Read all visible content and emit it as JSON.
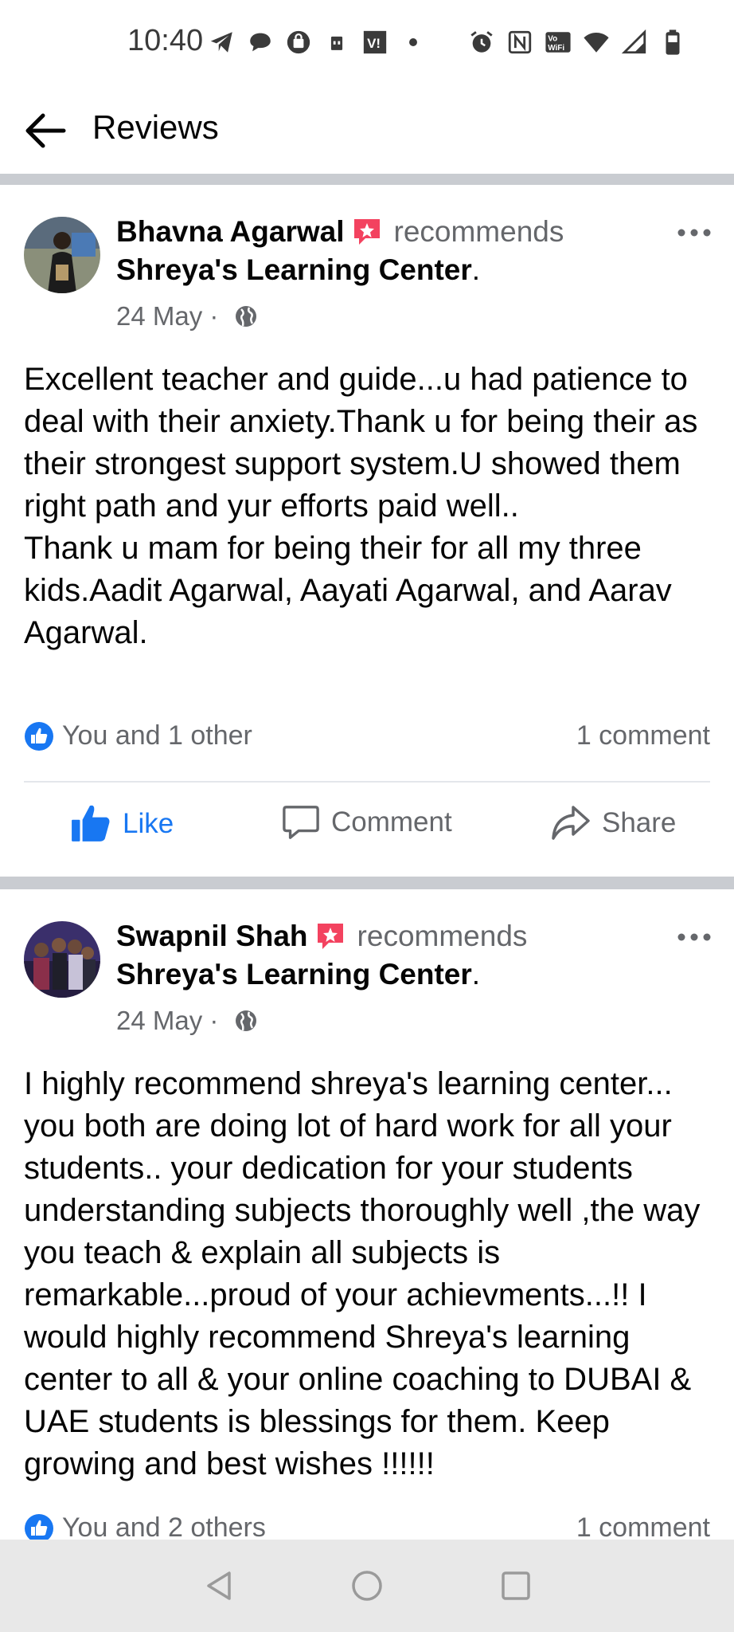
{
  "status_bar": {
    "time": "10:40",
    "left_icons": [
      "telegram-icon",
      "chat-bubble-icon",
      "shopping-bag-icon",
      "sim-icon",
      "vi-icon",
      "dot-icon"
    ],
    "right_icons": [
      "alarm-icon",
      "nfc-icon",
      "vowifi-icon",
      "wifi-icon",
      "signal-icon",
      "battery-icon"
    ]
  },
  "header": {
    "title": "Reviews",
    "back_icon": "back-arrow-icon"
  },
  "reviews": [
    {
      "author": "Bhavna Agarwal",
      "action": "recommends",
      "page": "Shreya's Learning Center",
      "page_suffix": ".",
      "date": "24 May",
      "separator": " · ",
      "text": "Excellent teacher and guide...u had patience to deal with their anxiety.Thank u for being their as their strongest support system.U showed them right path and yur efforts paid well..\nThank u mam for being their for all my three kids.Aadit Agarwal, Aayati Agarwal, and Aarav Agarwal.",
      "reactions": "You and 1 other",
      "comments": "1 comment"
    },
    {
      "author": "Swapnil Shah",
      "action": "recommends",
      "page": "Shreya's Learning Center",
      "page_suffix": ".",
      "date": "24 May",
      "separator": " · ",
      "text": "I highly recommend shreya's learning center... you both are doing lot of hard work for all your students.. your dedication for your students understanding subjects thoroughly well ,the way you teach & explain all subjects is remarkable...proud of your achievments...!! I would highly recommend Shreya's learning center to all & your online coaching to DUBAI & UAE students is blessings for them. Keep growing and best wishes !!!!!!",
      "reactions": "You and 2 others",
      "comments": "1 comment"
    }
  ],
  "actions": {
    "like": "Like",
    "comment": "Comment",
    "share": "Share"
  },
  "colors": {
    "accent": "#1877f2",
    "secondary_text": "#65676b",
    "divider": "#c9ccd1",
    "badge": "#f3425f"
  },
  "nav": {
    "icons": [
      "back-nav-icon",
      "home-nav-icon",
      "recents-nav-icon"
    ]
  }
}
